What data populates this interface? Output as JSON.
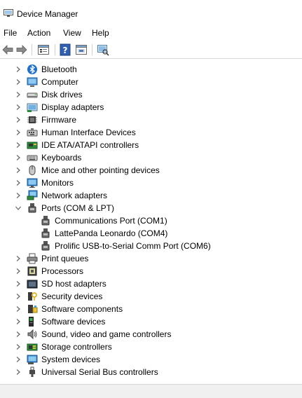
{
  "window": {
    "title": "Device Manager",
    "icon": "device-manager-icon"
  },
  "menu": {
    "file": "File",
    "action": "Action",
    "view": "View",
    "help": "Help"
  },
  "toolbar": {
    "back": "back-arrow-icon",
    "forward": "forward-arrow-icon",
    "properties": "properties-icon",
    "help": "help-icon",
    "update_driver": "update-driver-icon",
    "scan": "scan-hardware-icon"
  },
  "tree": {
    "items": [
      {
        "label": "Bluetooth",
        "icon": "bluetooth-icon",
        "expanded": false
      },
      {
        "label": "Computer",
        "icon": "computer-icon",
        "expanded": false
      },
      {
        "label": "Disk drives",
        "icon": "disk-drive-icon",
        "expanded": false
      },
      {
        "label": "Display adapters",
        "icon": "display-adapter-icon",
        "expanded": false
      },
      {
        "label": "Firmware",
        "icon": "firmware-icon",
        "expanded": false
      },
      {
        "label": "Human Interface Devices",
        "icon": "hid-icon",
        "expanded": false
      },
      {
        "label": "IDE ATA/ATAPI controllers",
        "icon": "ide-controller-icon",
        "expanded": false
      },
      {
        "label": "Keyboards",
        "icon": "keyboard-icon",
        "expanded": false
      },
      {
        "label": "Mice and other pointing devices",
        "icon": "mouse-icon",
        "expanded": false
      },
      {
        "label": "Monitors",
        "icon": "monitor-icon",
        "expanded": false
      },
      {
        "label": "Network adapters",
        "icon": "network-adapter-icon",
        "expanded": false
      },
      {
        "label": "Ports (COM & LPT)",
        "icon": "port-icon",
        "expanded": true
      },
      {
        "label": "Print queues",
        "icon": "printer-icon",
        "expanded": false
      },
      {
        "label": "Processors",
        "icon": "processor-icon",
        "expanded": false
      },
      {
        "label": "SD host adapters",
        "icon": "sd-host-icon",
        "expanded": false
      },
      {
        "label": "Security devices",
        "icon": "security-device-icon",
        "expanded": false
      },
      {
        "label": "Software components",
        "icon": "software-component-icon",
        "expanded": false
      },
      {
        "label": "Software devices",
        "icon": "software-device-icon",
        "expanded": false
      },
      {
        "label": "Sound, video and game controllers",
        "icon": "sound-icon",
        "expanded": false
      },
      {
        "label": "Storage controllers",
        "icon": "storage-controller-icon",
        "expanded": false
      },
      {
        "label": "System devices",
        "icon": "system-device-icon",
        "expanded": false
      },
      {
        "label": "Universal Serial Bus controllers",
        "icon": "usb-icon",
        "expanded": false
      }
    ],
    "ports_children": [
      {
        "label": "Communications Port (COM1)",
        "icon": "port-icon"
      },
      {
        "label": "LattePanda Leonardo (COM4)",
        "icon": "port-icon"
      },
      {
        "label": "Prolific USB-to-Serial Comm Port (COM6)",
        "icon": "port-icon"
      }
    ]
  }
}
